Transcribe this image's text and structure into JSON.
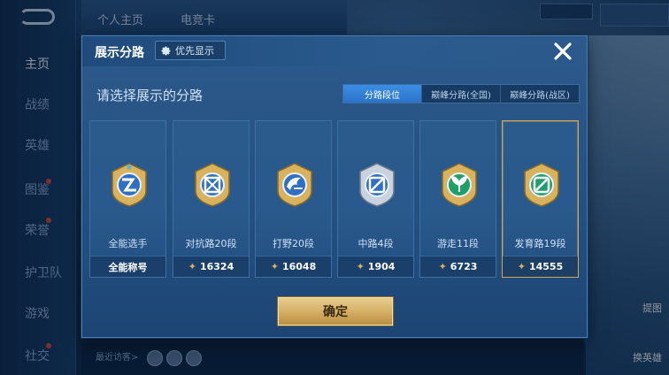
{
  "background": {
    "nav": [
      {
        "label": "主页",
        "active": true
      },
      {
        "label": "战绩",
        "active": false
      },
      {
        "label": "英雄",
        "active": false
      },
      {
        "label": "图鉴",
        "active": false
      },
      {
        "label": "荣誉",
        "active": false
      },
      {
        "label": "护卫队",
        "active": false
      },
      {
        "label": "游戏",
        "active": false
      },
      {
        "label": "社交",
        "active": false
      }
    ],
    "top_tabs": [
      "个人主页",
      "电竞卡"
    ],
    "visitor_text": "最近访客>",
    "right_labels": [
      "提图",
      "换英雄"
    ]
  },
  "dialog": {
    "title": "展示分路",
    "priority_label": "优先显示",
    "subtitle": "请选择展示的分路",
    "segments": [
      {
        "label": "分路段位",
        "active": true
      },
      {
        "label": "巅峰分路(全国)",
        "active": false
      },
      {
        "label": "巅峰分路(战区)",
        "active": false
      }
    ],
    "cards": [
      {
        "label": "全能选手",
        "footer": "全能称号",
        "has_star": false,
        "selected": false,
        "emblem": "all-round-emblem-icon"
      },
      {
        "label": "对抗路20段",
        "footer": "16324",
        "has_star": true,
        "selected": false,
        "emblem": "clash-lane-emblem-icon"
      },
      {
        "label": "打野20段",
        "footer": "16048",
        "has_star": true,
        "selected": false,
        "emblem": "jungle-emblem-icon"
      },
      {
        "label": "中路4段",
        "footer": "1904",
        "has_star": true,
        "selected": false,
        "emblem": "mid-lane-emblem-icon"
      },
      {
        "label": "游走11段",
        "footer": "6723",
        "has_star": true,
        "selected": false,
        "emblem": "roam-emblem-icon"
      },
      {
        "label": "发育路19段",
        "footer": "14555",
        "has_star": true,
        "selected": true,
        "emblem": "farm-lane-emblem-icon"
      }
    ],
    "confirm_label": "确定"
  },
  "colors": {
    "accent_gold": "#d8a45a",
    "segment_active": "#2b74c8",
    "star": "#d9b25a"
  }
}
